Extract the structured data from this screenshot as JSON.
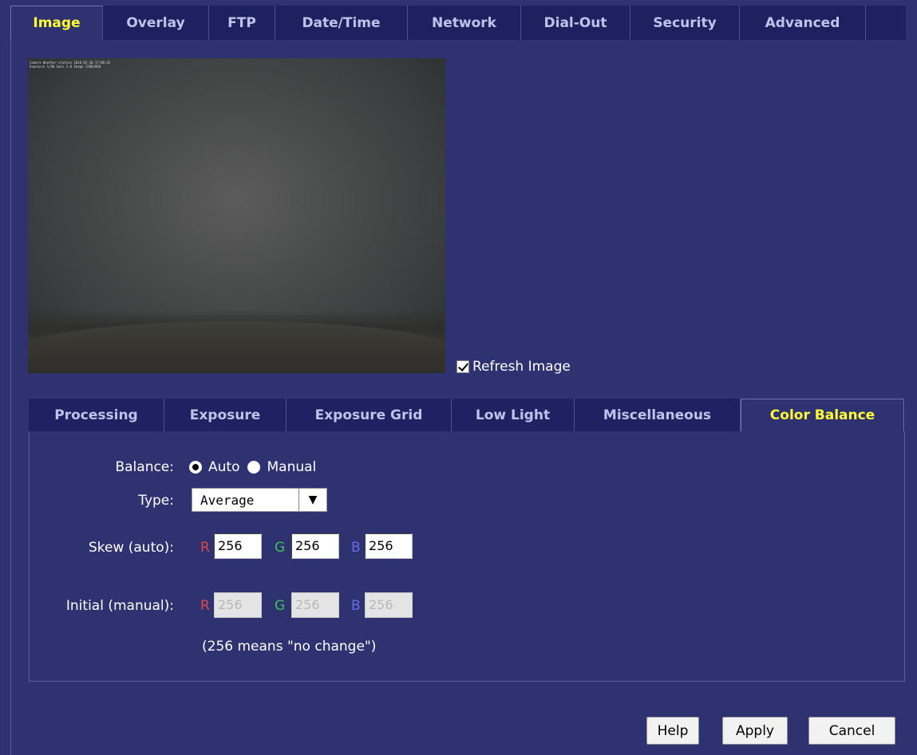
{
  "top_tabs": [
    "Image",
    "Overlay",
    "FTP",
    "Date/Time",
    "Network",
    "Dial-Out",
    "Security",
    "Advanced"
  ],
  "top_tabs_active": "Image",
  "preview": {
    "stamp_line1": "Camera Weather-station 2010-05-30 17:08:45",
    "stamp_line2": "Exposure 1/60 Gain 2.0 Image 1280x960",
    "refresh_label": "Refresh Image",
    "refresh_checked": true
  },
  "sub_tabs": [
    "Processing",
    "Exposure",
    "Exposure Grid",
    "Low Light",
    "Miscellaneous",
    "Color Balance"
  ],
  "sub_tabs_active": "Color Balance",
  "color_balance": {
    "balance_label": "Balance:",
    "balance_options": [
      "Auto",
      "Manual"
    ],
    "balance_selected": "Auto",
    "type_label": "Type:",
    "type_value": "Average",
    "skew_label": "Skew (auto):",
    "initial_label": "Initial (manual):",
    "channel_r": "R",
    "channel_g": "G",
    "channel_b": "B",
    "skew": {
      "r": "256",
      "g": "256",
      "b": "256"
    },
    "initial": {
      "r": "256",
      "g": "256",
      "b": "256"
    },
    "note": "(256 means \"no change\")"
  },
  "buttons": {
    "help": "Help",
    "apply": "Apply",
    "cancel": "Cancel"
  },
  "colors": {
    "background": "#2f3270",
    "active_tab_text": "#ffff33",
    "inactive_tab_text": "#bfc3ea"
  }
}
